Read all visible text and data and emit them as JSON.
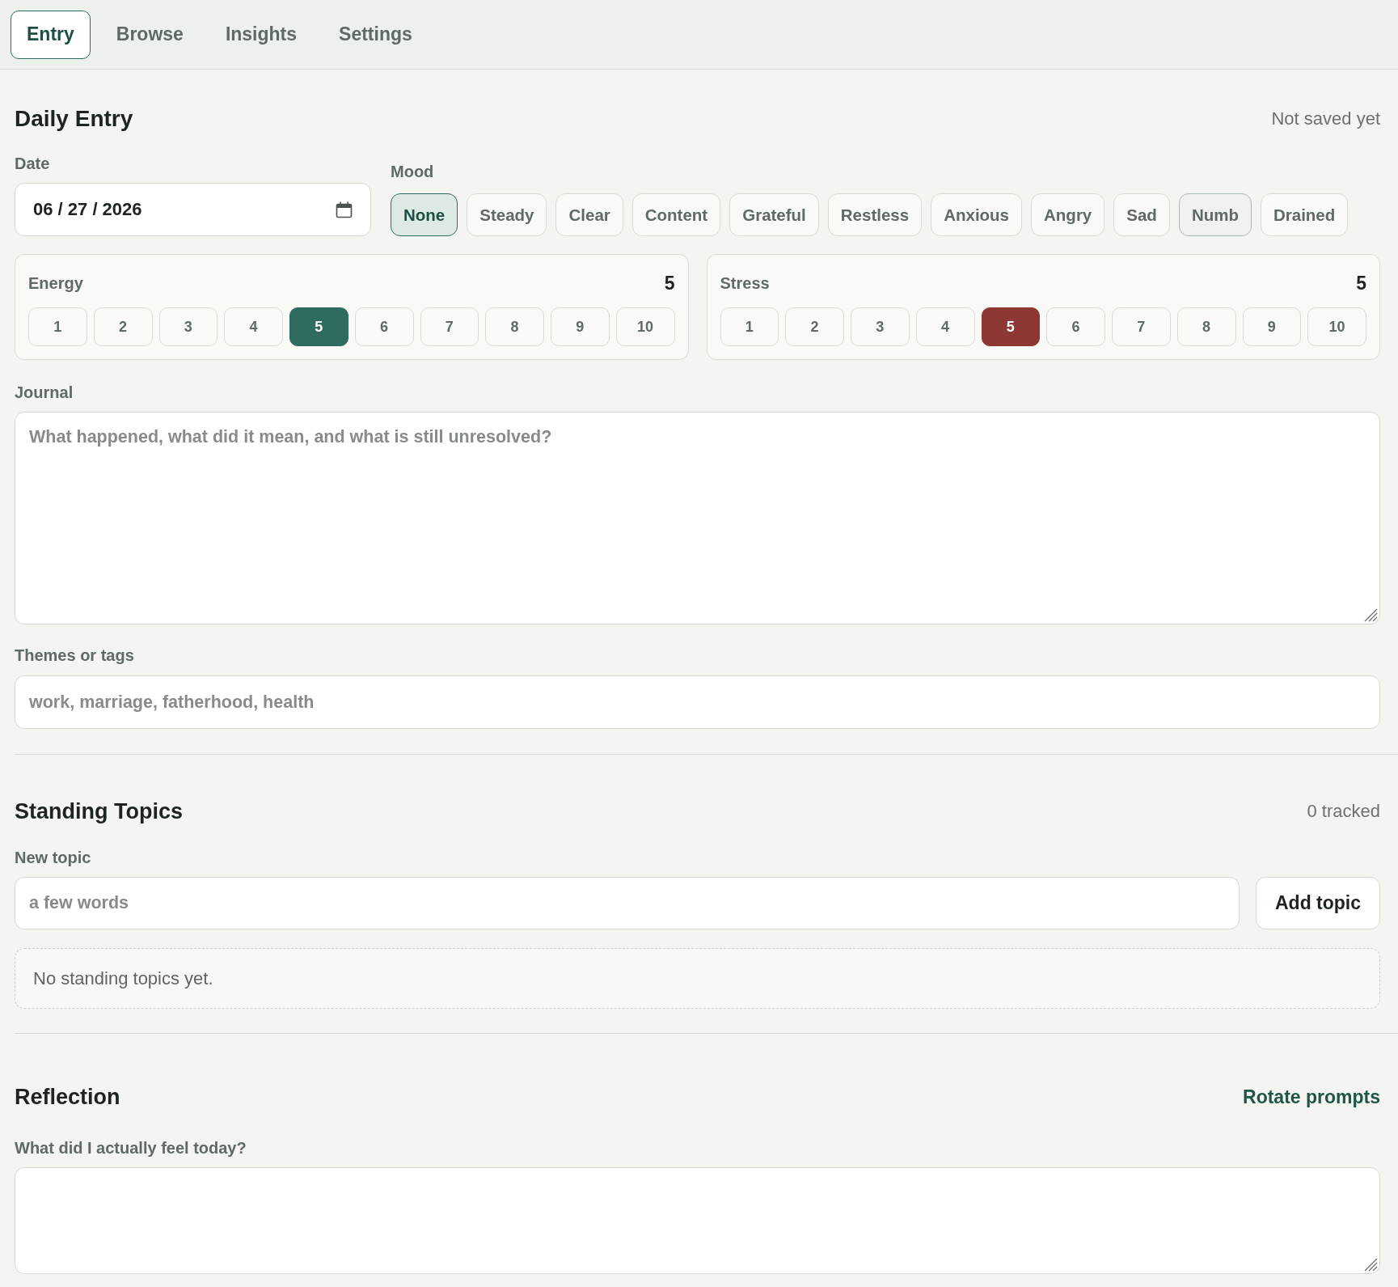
{
  "tabs": [
    {
      "label": "Entry",
      "selected": true
    },
    {
      "label": "Browse",
      "selected": false
    },
    {
      "label": "Insights",
      "selected": false
    },
    {
      "label": "Settings",
      "selected": false
    }
  ],
  "daily_entry": {
    "title": "Daily Entry",
    "status": "Not saved yet",
    "date": {
      "label": "Date",
      "value": "06 / 27 / 2026"
    },
    "mood": {
      "label": "Mood",
      "options": [
        {
          "label": "None",
          "selected": true,
          "hovered": false
        },
        {
          "label": "Steady",
          "selected": false,
          "hovered": false
        },
        {
          "label": "Clear",
          "selected": false,
          "hovered": false
        },
        {
          "label": "Content",
          "selected": false,
          "hovered": false
        },
        {
          "label": "Grateful",
          "selected": false,
          "hovered": false
        },
        {
          "label": "Restless",
          "selected": false,
          "hovered": false
        },
        {
          "label": "Anxious",
          "selected": false,
          "hovered": false
        },
        {
          "label": "Angry",
          "selected": false,
          "hovered": false
        },
        {
          "label": "Sad",
          "selected": false,
          "hovered": false
        },
        {
          "label": "Numb",
          "selected": false,
          "hovered": true
        },
        {
          "label": "Drained",
          "selected": false,
          "hovered": false
        }
      ]
    },
    "scales": [
      {
        "kind": "energy",
        "label": "Energy",
        "value": "5",
        "options": [
          {
            "label": "1",
            "selected": false
          },
          {
            "label": "2",
            "selected": false
          },
          {
            "label": "3",
            "selected": false
          },
          {
            "label": "4",
            "selected": false
          },
          {
            "label": "5",
            "selected": true
          },
          {
            "label": "6",
            "selected": false
          },
          {
            "label": "7",
            "selected": false
          },
          {
            "label": "8",
            "selected": false
          },
          {
            "label": "9",
            "selected": false
          },
          {
            "label": "10",
            "selected": false
          }
        ]
      },
      {
        "kind": "stress",
        "label": "Stress",
        "value": "5",
        "options": [
          {
            "label": "1",
            "selected": false
          },
          {
            "label": "2",
            "selected": false
          },
          {
            "label": "3",
            "selected": false
          },
          {
            "label": "4",
            "selected": false
          },
          {
            "label": "5",
            "selected": true
          },
          {
            "label": "6",
            "selected": false
          },
          {
            "label": "7",
            "selected": false
          },
          {
            "label": "8",
            "selected": false
          },
          {
            "label": "9",
            "selected": false
          },
          {
            "label": "10",
            "selected": false
          }
        ]
      }
    ],
    "journal": {
      "label": "Journal",
      "placeholder": "What happened, what did it mean, and what is still unresolved?"
    },
    "tags": {
      "label": "Themes or tags",
      "placeholder": "work, marriage, fatherhood, health"
    }
  },
  "standing_topics": {
    "title": "Standing Topics",
    "count": "0 tracked",
    "new_topic": {
      "label": "New topic",
      "placeholder": "a few words"
    },
    "add_button": "Add topic",
    "empty_message": "No standing topics yet."
  },
  "reflection": {
    "title": "Reflection",
    "rotate_link": "Rotate prompts",
    "prompt": {
      "label": "What did I actually feel today?"
    }
  }
}
